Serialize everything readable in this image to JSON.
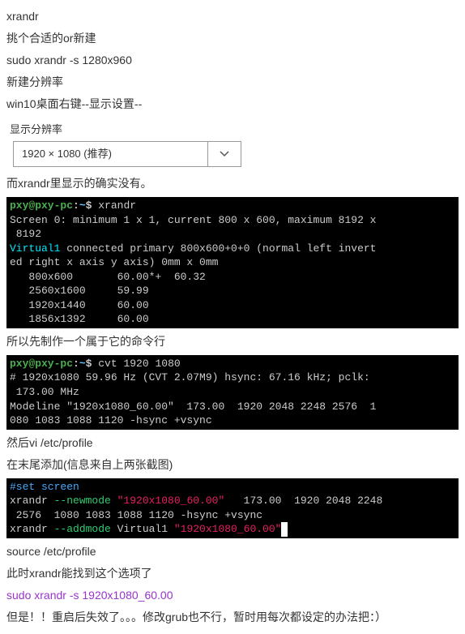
{
  "line1": "xrandr",
  "line2": "挑个合适的or新建",
  "line3": "sudo xrandr -s 1280x960",
  "line4": "新建分辨率",
  "line5": "win10桌面右键--显示设置--",
  "resLabel": "显示分辨率",
  "resValue": "1920 × 1080 (推荐)",
  "line6": "而xrandr里显示的确实没有。",
  "term1": {
    "prompt": {
      "user": "pxy@pxy-pc",
      "sep": ":",
      "path": "~",
      "end": "$ "
    },
    "cmd": "xrandr",
    "l1": "Screen 0: minimum 1 x 1, current 800 x 600, maximum 8192 x",
    "l2": " 8192",
    "l3a": "Virtual1 ",
    "l3b": "connected primary 800x600+0+0 (normal left invert",
    "l4": "ed right x axis y axis) 0mm x 0mm",
    "l5": "   800x600       60.00*+  60.32",
    "l6": "   2560x1600     59.99",
    "l7": "   1920x1440     60.00",
    "l8": "   1856x1392     60.00"
  },
  "line7": "所以先制作一个属于它的命令行",
  "term2": {
    "prompt": {
      "user": "pxy@pxy-pc",
      "sep": ":",
      "path": "~",
      "end": "$ "
    },
    "cmd": "cvt 1920 1080",
    "l1": "# 1920x1080 59.96 Hz (CVT 2.07M9) hsync: 67.16 kHz; pclk:",
    "l2": " 173.00 MHz",
    "l3": "Modeline \"1920x1080_60.00\"  173.00  1920 2048 2248 2576  1",
    "l4": "080 1083 1088 1120 -hsync +vsync"
  },
  "line8": "然后vi /etc/profile",
  "line9": "在末尾添加(信息来自上两张截图)",
  "term3": {
    "comment": "#set screen",
    "r1a": "xrandr ",
    "r1b": "--newmode ",
    "r1c": "\"1920x1080_60.00\"",
    "r1d": "   173.00  1920 2048 2248",
    "r2": " 2576  1080 1083 1088 1120 -hsync +vsync",
    "r3a": "xrandr ",
    "r3b": "--addmode ",
    "r3c": "Virtual1 ",
    "r3d": "\"1920x1080_60.00\""
  },
  "line10": "source /etc/profile",
  "line11": "此时xrandr能找到这个选项了",
  "line12": "sudo xrandr -s 1920x1080_60.00",
  "line13": "但是！！重启后失效了。。。修改grub也不行，暂时用每次都设定的办法把：）"
}
